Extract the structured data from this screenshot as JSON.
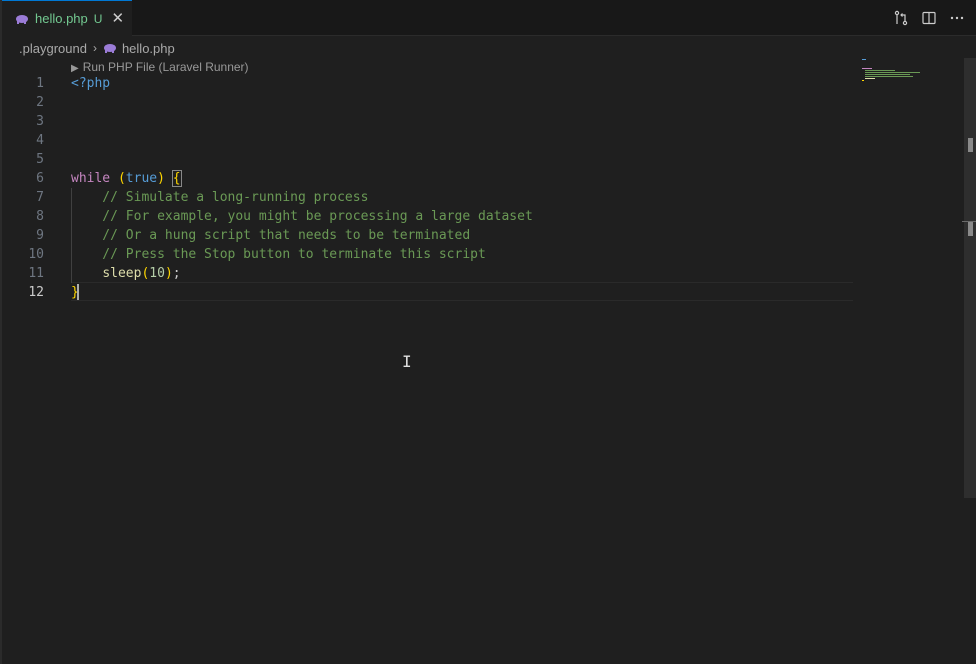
{
  "tab": {
    "label": "hello.php",
    "status": "U",
    "close": "✕"
  },
  "breadcrumb": {
    "folder": ".playground",
    "file": "hello.php",
    "separator": "›"
  },
  "codelens": {
    "label": "Run PHP File (Laravel Runner)",
    "icon": "play-icon"
  },
  "editor": {
    "active_line": 12,
    "lines": [
      {
        "num": "1",
        "text": "<?php"
      },
      {
        "num": "2",
        "text": ""
      },
      {
        "num": "3",
        "text": ""
      },
      {
        "num": "4",
        "text": ""
      },
      {
        "num": "5",
        "text": ""
      },
      {
        "num": "6",
        "text": "while (true) {"
      },
      {
        "num": "7",
        "text": "    // Simulate a long-running process"
      },
      {
        "num": "8",
        "text": "    // For example, you might be processing a large dataset"
      },
      {
        "num": "9",
        "text": "    // Or a hung script that needs to be terminated"
      },
      {
        "num": "10",
        "text": "    // Press the Stop button to terminate this script"
      },
      {
        "num": "11",
        "text": "    sleep(10);"
      },
      {
        "num": "12",
        "text": "}"
      }
    ]
  },
  "toolbar_icons": [
    "git-compare-icon",
    "split-editor-icon",
    "more-actions-icon"
  ],
  "colors": {
    "modified_green": "#73c991",
    "accent_blue": "#0078d4",
    "php_purple": "#9b7cd7"
  }
}
